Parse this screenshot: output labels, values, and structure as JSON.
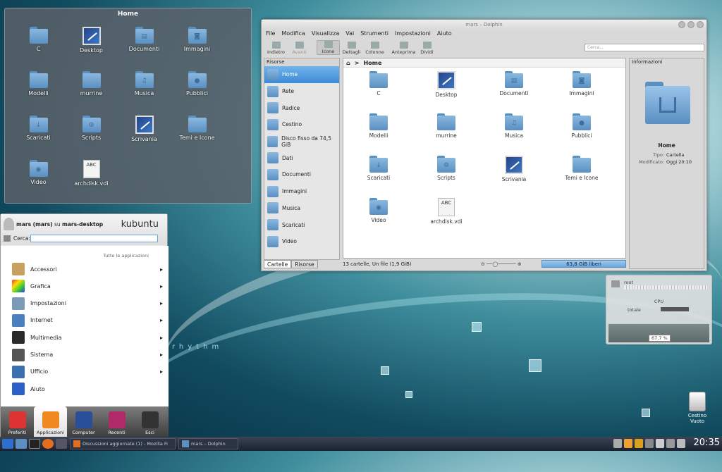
{
  "desktop": {
    "wallpaper_text": "rhythm"
  },
  "folderview": {
    "title": "Home",
    "items": [
      {
        "label": "C",
        "icon": "folder-icon"
      },
      {
        "label": "Desktop",
        "icon": "desktop-icon"
      },
      {
        "label": "Documenti",
        "icon": "documents-folder-icon"
      },
      {
        "label": "Immagini",
        "icon": "pictures-folder-icon"
      },
      {
        "label": "Modelli",
        "icon": "folder-icon"
      },
      {
        "label": "murrine",
        "icon": "folder-icon"
      },
      {
        "label": "Musica",
        "icon": "music-folder-icon"
      },
      {
        "label": "Pubblici",
        "icon": "public-folder-icon"
      },
      {
        "label": "Scaricati",
        "icon": "downloads-folder-icon"
      },
      {
        "label": "Scripts",
        "icon": "scripts-folder-icon"
      },
      {
        "label": "Scrivania",
        "icon": "desktop-icon"
      },
      {
        "label": "Temi e Icone",
        "icon": "folder-icon"
      },
      {
        "label": "Video",
        "icon": "video-folder-icon"
      },
      {
        "label": "archdisk.vdi",
        "icon": "file-icon"
      }
    ]
  },
  "dolphin": {
    "title": "mars – Dolphin",
    "menu": [
      "File",
      "Modifica",
      "Visualizza",
      "Vai",
      "Strumenti",
      "Impostazioni",
      "Aiuto"
    ],
    "toolbar": [
      {
        "label": "Indietro",
        "state": "normal"
      },
      {
        "label": "Avanti",
        "state": "disabled"
      },
      {
        "label": "Icone",
        "state": "active"
      },
      {
        "label": "Dettagli",
        "state": "normal"
      },
      {
        "label": "Colonne",
        "state": "normal"
      },
      {
        "label": "Anteprima",
        "state": "normal"
      },
      {
        "label": "Dividi",
        "state": "normal"
      }
    ],
    "search_placeholder": "Cerca...",
    "places_title": "Risorse",
    "places": [
      {
        "label": "Home",
        "selected": true
      },
      {
        "label": "Rete",
        "selected": false
      },
      {
        "label": "Radice",
        "selected": false
      },
      {
        "label": "Cestino",
        "selected": false
      },
      {
        "label": "Disco fisso da 74,5 GiB",
        "selected": false
      },
      {
        "label": "Dati",
        "selected": false
      },
      {
        "label": "Documenti",
        "selected": false
      },
      {
        "label": "Immagini",
        "selected": false
      },
      {
        "label": "Musica",
        "selected": false
      },
      {
        "label": "Scaricati",
        "selected": false
      },
      {
        "label": "Video",
        "selected": false
      }
    ],
    "panel_tabs": [
      "Cartelle",
      "Risorse"
    ],
    "breadcrumb": "Home",
    "items": [
      {
        "label": "C"
      },
      {
        "label": "Desktop"
      },
      {
        "label": "Documenti"
      },
      {
        "label": "Immagini"
      },
      {
        "label": "Modelli"
      },
      {
        "label": "murrine"
      },
      {
        "label": "Musica"
      },
      {
        "label": "Pubblici"
      },
      {
        "label": "Scaricati"
      },
      {
        "label": "Scripts"
      },
      {
        "label": "Scrivania"
      },
      {
        "label": "Temi e Icone"
      },
      {
        "label": "Video"
      },
      {
        "label": "archdisk.vdi"
      }
    ],
    "status": "13 cartelle, Un file (1,9 GiB)",
    "free_space": "63,8 GiB liberi",
    "info_title": "Informazioni",
    "info_name": "Home",
    "info_rows": [
      {
        "key": "Tipo:",
        "value": "Cartella"
      },
      {
        "key": "Modificato:",
        "value": "Oggi 20:10"
      }
    ]
  },
  "sysmon": {
    "device": "root",
    "cpu_label": "CPU",
    "cpu_row": "totale",
    "cpu_percent": "67,7 %"
  },
  "kickoff": {
    "user": "mars (mars)",
    "user_host_sep": "su",
    "host": "mars-desktop",
    "brand": "kubuntu",
    "search_label": "Cerca:",
    "all_apps": "Tutte le applicazioni",
    "categories": [
      "Accessori",
      "Grafica",
      "Impostazioni",
      "Internet",
      "Multimedia",
      "Sistema",
      "Ufficio",
      "Aiuto"
    ],
    "tabs": [
      {
        "label": "Preferiti",
        "active": false
      },
      {
        "label": "Applicazioni",
        "active": true
      },
      {
        "label": "Computer",
        "active": false
      },
      {
        "label": "Recenti",
        "active": false
      },
      {
        "label": "Esci",
        "active": false
      }
    ]
  },
  "trash": {
    "label_line1": "Cestino",
    "label_line2": "Vuoto"
  },
  "taskbar": {
    "tasks": [
      "Discussioni aggiornate (1) - Mozilla Fi",
      "mars – Dolphin"
    ],
    "clock": "20:35"
  }
}
